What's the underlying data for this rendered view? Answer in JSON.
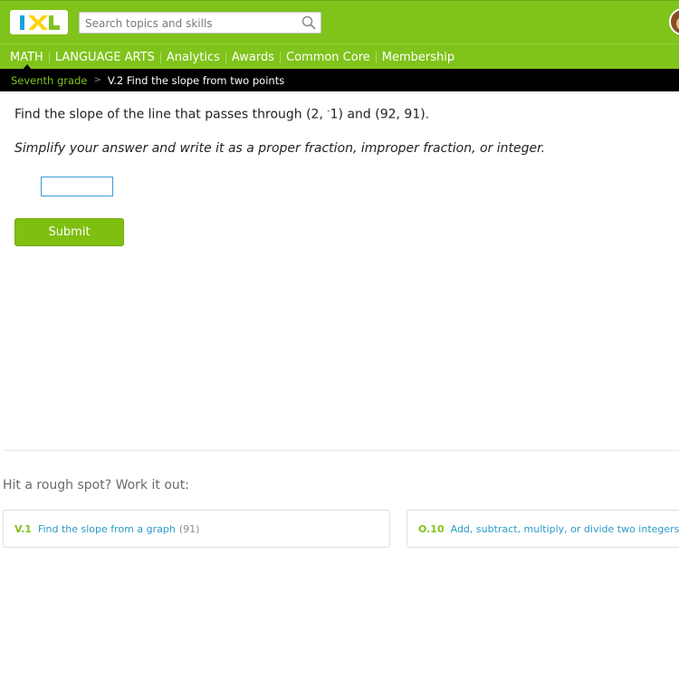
{
  "header": {
    "logo_text": "IXL",
    "search": {
      "placeholder": "Search topics and skills",
      "value": ""
    },
    "nav": [
      {
        "label": "MATH"
      },
      {
        "label": "LANGUAGE ARTS"
      },
      {
        "label": "Analytics"
      },
      {
        "label": "Awards"
      },
      {
        "label": "Common Core"
      },
      {
        "label": "Membership"
      }
    ]
  },
  "breadcrumb": {
    "grade": "Seventh grade",
    "separator": ">",
    "skill": "V.2 Find the slope from two points"
  },
  "problem": {
    "question_prefix": "Find the slope of the line that passes through (2, ",
    "question_superscript": "-",
    "question_suffix": "1) and (92, 91).",
    "instruction": "Simplify your answer and write it as a proper fraction, improper fraction, or integer.",
    "answer_value": "",
    "submit_label": "Submit"
  },
  "rough_spot": {
    "heading": "Hit a rough spot? Work it out:",
    "cards": [
      {
        "code": "V.1",
        "name": "Find the slope from a graph",
        "count": "(91)"
      },
      {
        "code": "O.10",
        "name": "Add, subtract, multiply, or divide two integers",
        "count": ""
      }
    ]
  },
  "colors": {
    "brand_green": "#7fc31b",
    "breadcrumb_bg": "#000000",
    "link_blue": "#2a9bc9",
    "input_border": "#3a9bd8"
  },
  "icons": {
    "search": "search-icon",
    "avatar": "avatar"
  }
}
